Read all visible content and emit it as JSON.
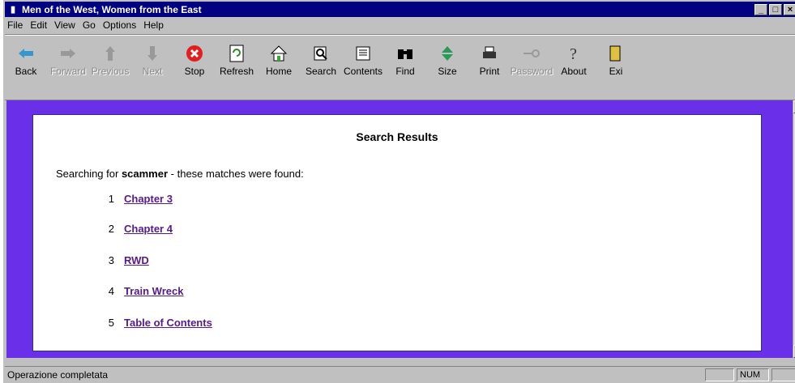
{
  "window": {
    "title": "Men of the West, Women from the East"
  },
  "menu": [
    "File",
    "Edit",
    "View",
    "Go",
    "Options",
    "Help"
  ],
  "toolbar": [
    {
      "label": "Back",
      "icon": "back-arrow-icon",
      "enabled": true
    },
    {
      "label": "Forward",
      "icon": "forward-arrow-icon",
      "enabled": false
    },
    {
      "label": "Previous",
      "icon": "up-arrow-icon",
      "enabled": false
    },
    {
      "label": "Next",
      "icon": "down-arrow-icon",
      "enabled": false
    },
    {
      "label": "Stop",
      "icon": "stop-icon",
      "enabled": true
    },
    {
      "label": "Refresh",
      "icon": "refresh-icon",
      "enabled": true
    },
    {
      "label": "Home",
      "icon": "home-icon",
      "enabled": true
    },
    {
      "label": "Search",
      "icon": "search-icon",
      "enabled": true
    },
    {
      "label": "Contents",
      "icon": "contents-icon",
      "enabled": true
    },
    {
      "label": "Find",
      "icon": "binoculars-icon",
      "enabled": true
    },
    {
      "label": "Size",
      "icon": "size-icon",
      "enabled": true
    },
    {
      "label": "Print",
      "icon": "printer-icon",
      "enabled": true
    },
    {
      "label": "Password",
      "icon": "key-icon",
      "enabled": false
    },
    {
      "label": "About",
      "icon": "question-icon",
      "enabled": true
    },
    {
      "label": "Exi",
      "icon": "exit-door-icon",
      "enabled": true
    }
  ],
  "content": {
    "heading": "Search Results",
    "intro_prefix": "Searching for ",
    "search_term": "scammer",
    "intro_suffix": " - these matches were found:",
    "results": [
      {
        "num": "1",
        "title": "Chapter 3"
      },
      {
        "num": "2",
        "title": "Chapter 4"
      },
      {
        "num": "3",
        "title": "RWD"
      },
      {
        "num": "4",
        "title": "Train Wreck"
      },
      {
        "num": "5",
        "title": "Table of Contents"
      }
    ]
  },
  "status": {
    "message": "Operazione completata",
    "num": "NUM"
  },
  "colors": {
    "titlebar": "#000080",
    "content_bg": "#6a2fe8",
    "link": "#551a8b"
  }
}
